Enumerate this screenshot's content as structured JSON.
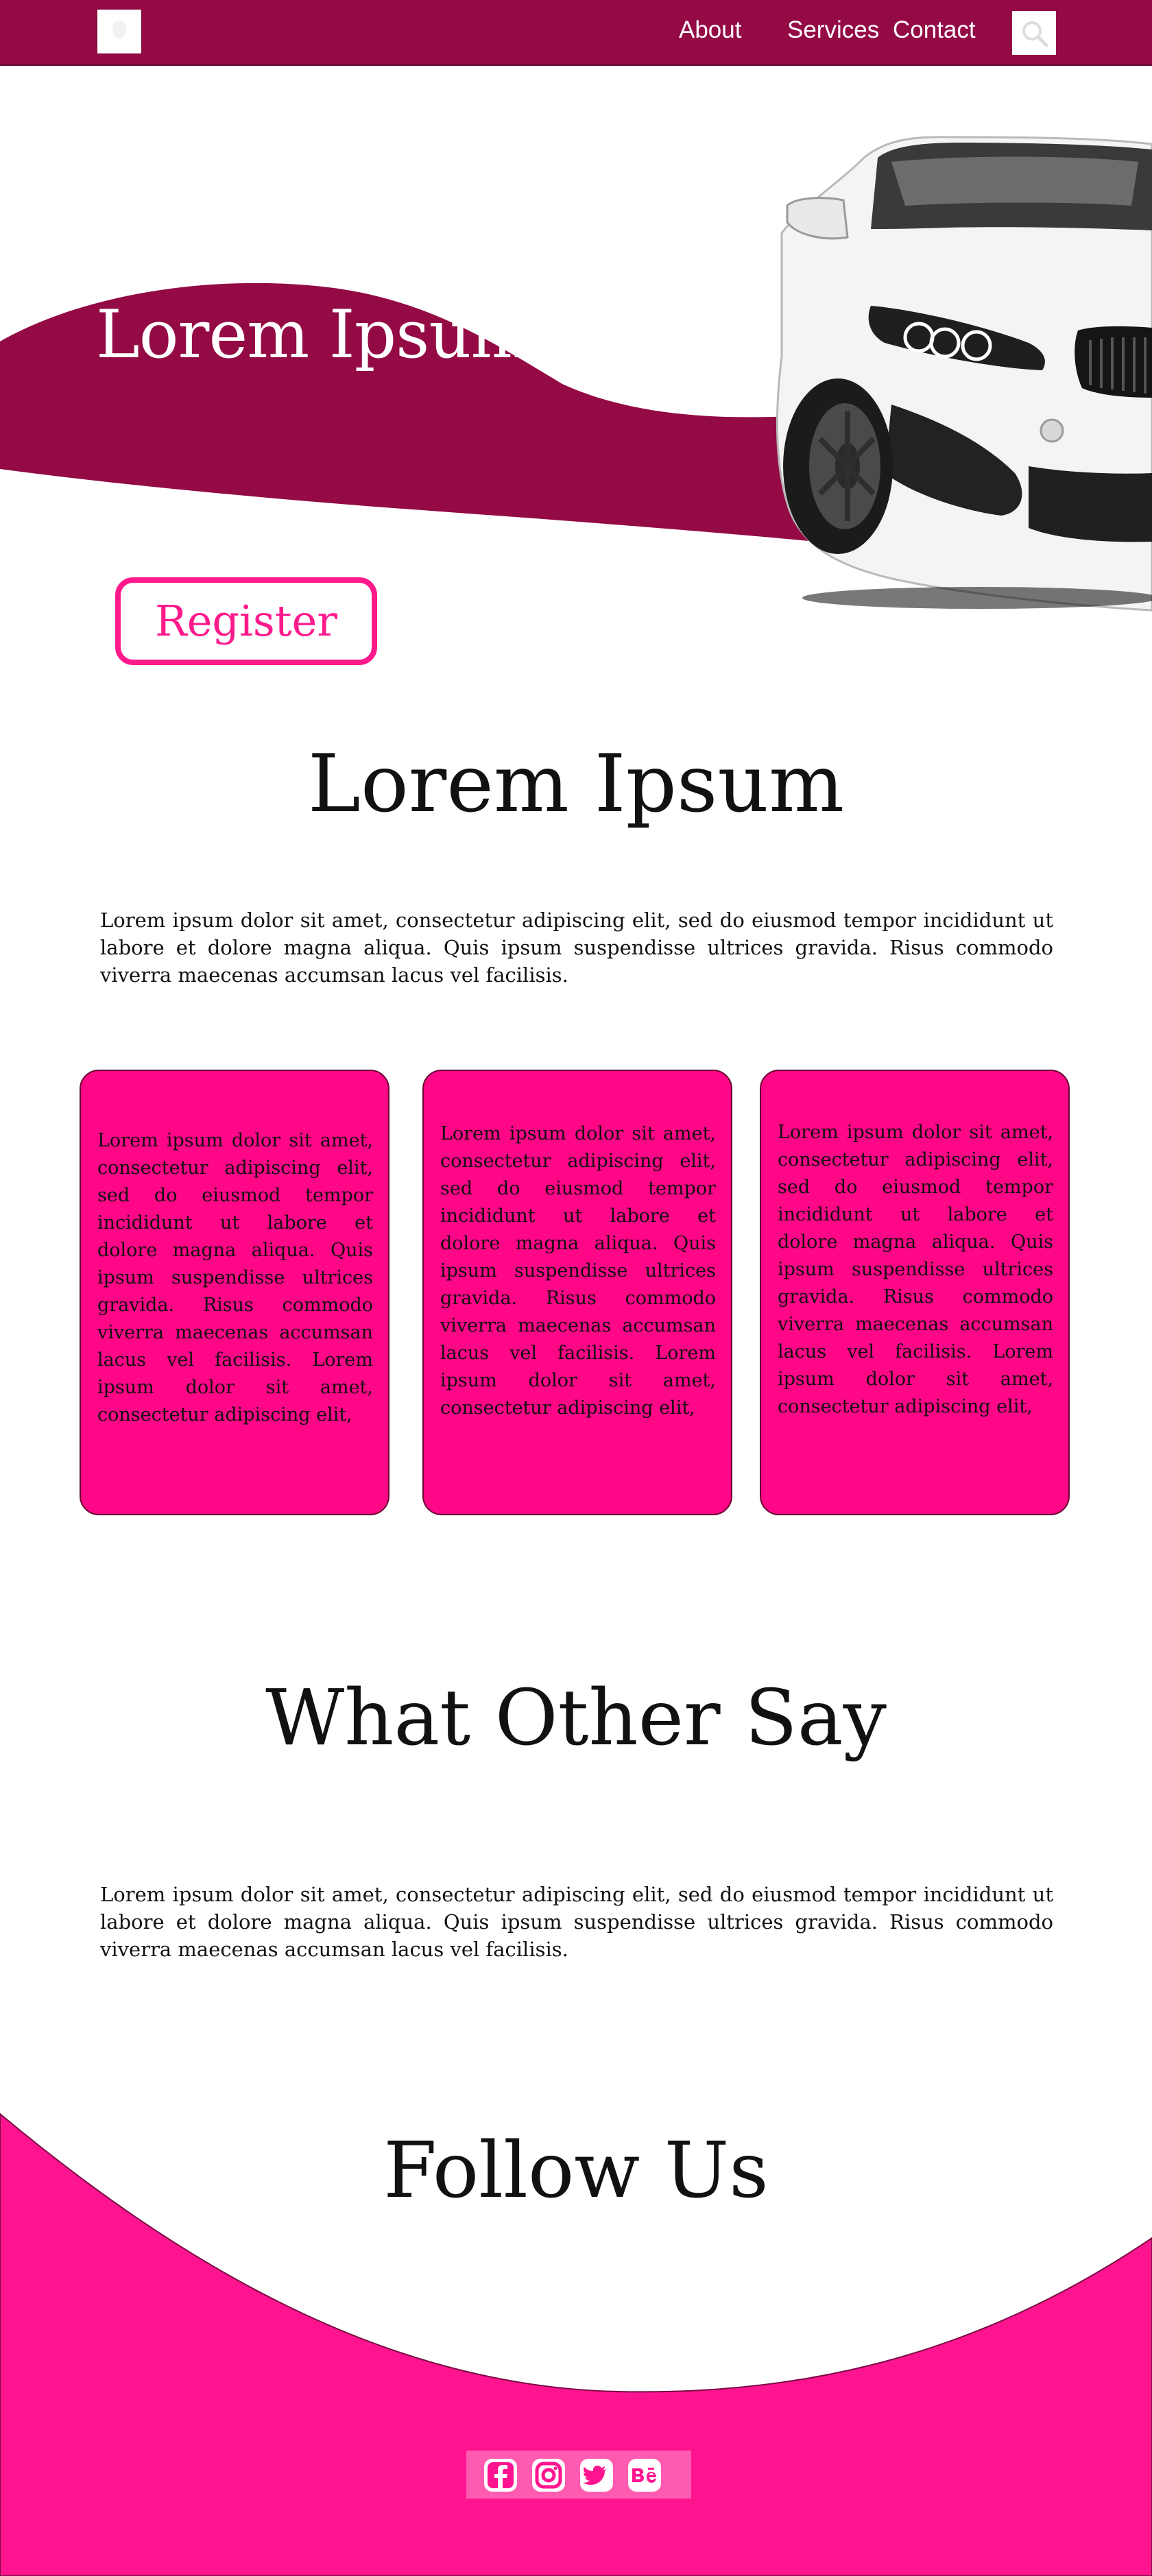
{
  "nav": {
    "links": [
      "About",
      "Services",
      "Contact"
    ]
  },
  "hero": {
    "title": "Lorem Ipsum",
    "register_label": "Register"
  },
  "intro": {
    "heading": "Lorem Ipsum",
    "paragraph": "Lorem ipsum dolor sit amet, consectetur adipiscing elit, sed do eiusmod tempor incididunt ut labore et dolore magna aliqua. Quis ipsum suspendisse ultrices gravida. Risus commodo viverra maecenas accumsan lacus vel facilisis."
  },
  "cards": [
    {
      "text": "Lorem ipsum dolor sit amet, consectetur adipiscing elit, sed do eiusmod tempor incididunt ut labore et dolore magna aliqua. Quis ipsum suspendisse ultrices gravida. Risus commodo viverra maecenas accumsan lacus vel facilisis. Lorem ipsum dolor sit amet, consectetur adipiscing elit,"
    },
    {
      "text": "Lorem ipsum dolor sit amet, consectetur adipiscing elit, sed do eiusmod tempor incididunt ut labore et dolore magna aliqua. Quis ipsum suspendisse ultrices gravida. Risus commodo viverra maecenas accumsan lacus vel facilisis. Lorem ipsum dolor sit amet, consectetur adipiscing elit,"
    },
    {
      "text": "Lorem ipsum dolor sit amet, consectetur adipiscing elit, sed do eiusmod tempor incididunt ut labore et dolore magna aliqua. Quis ipsum suspendisse ultrices gravida. Risus commodo viverra maecenas accumsan lacus vel facilisis. Lorem ipsum dolor sit amet, consectetur adipiscing elit,"
    }
  ],
  "testimonials": {
    "heading": "What Other Say",
    "paragraph": "Lorem ipsum dolor sit amet, consectetur adipiscing elit, sed do eiusmod tempor incididunt ut labore et dolore magna aliqua. Quis ipsum suspendisse ultrices gravida. Risus commodo viverra maecenas accumsan lacus vel facilisis."
  },
  "follow": {
    "heading": "Follow Us",
    "social_icons": [
      "facebook-icon",
      "instagram-icon",
      "twitter-icon",
      "behance-icon"
    ]
  },
  "colors": {
    "nav_bg": "#940a45",
    "hero_wave": "#940a45",
    "accent_pink": "#ff1a8c",
    "card_bg": "#ff0787",
    "footer_bg": "#ff1490"
  }
}
